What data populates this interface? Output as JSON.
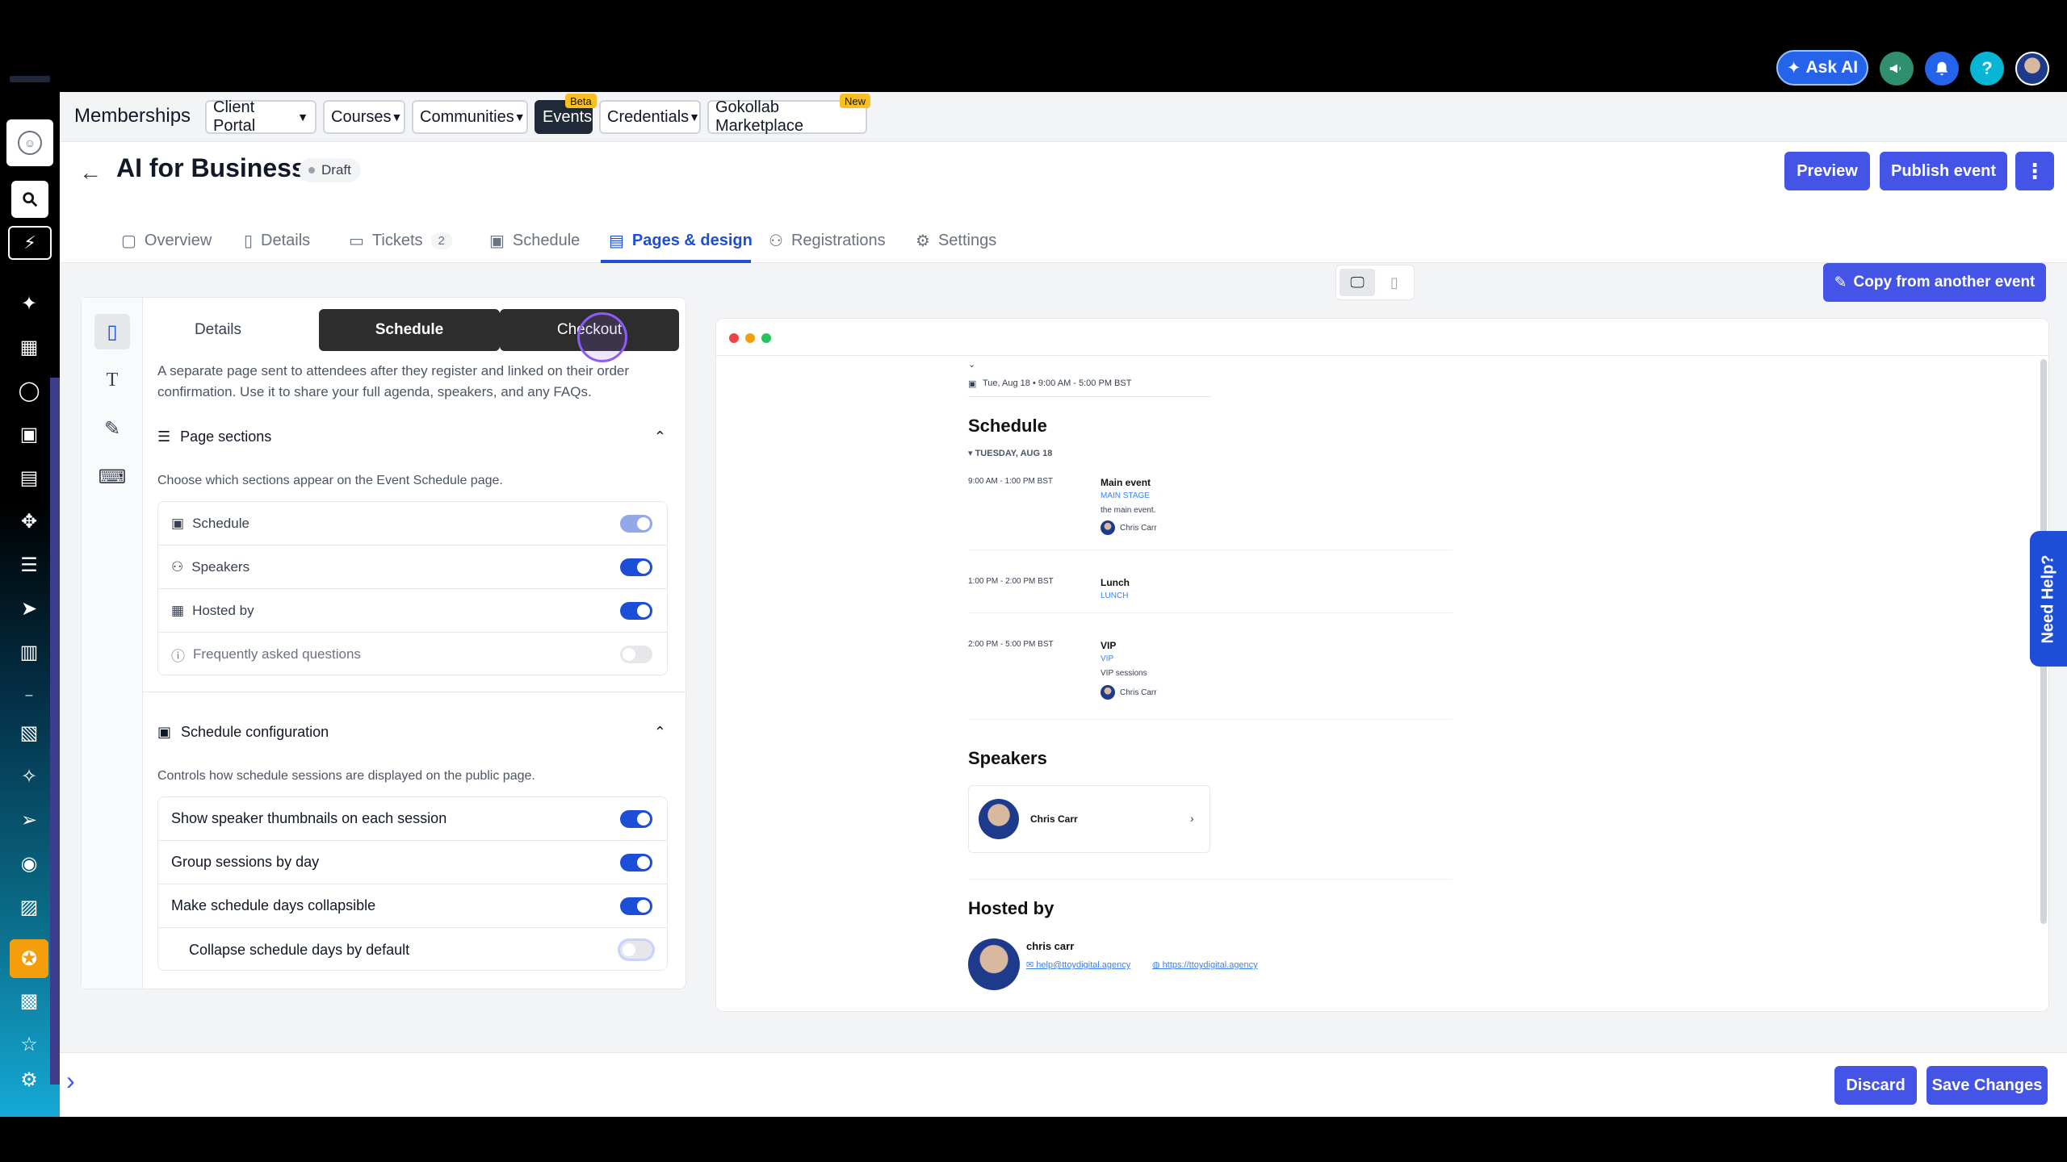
{
  "topbar": {
    "ask_ai": "Ask AI",
    "icons": [
      "phone-icon",
      "sparkle-icon",
      "megaphone-icon",
      "bell-icon",
      "help-icon",
      "user-avatar"
    ]
  },
  "nav": {
    "title": "Memberships",
    "items": [
      {
        "label": "Client Portal",
        "dropdown": true
      },
      {
        "label": "Courses",
        "dropdown": true
      },
      {
        "label": "Communities",
        "dropdown": true
      },
      {
        "label": "Events",
        "dropdown": false,
        "badge": "Beta",
        "active": true
      },
      {
        "label": "Credentials",
        "dropdown": true
      },
      {
        "label": "Gokollab Marketplace",
        "dropdown": false,
        "badge": "New"
      }
    ]
  },
  "header": {
    "title": "AI for Business",
    "status": "Draft",
    "preview_label": "Preview",
    "publish_label": "Publish event",
    "tabs": [
      {
        "label": "Overview"
      },
      {
        "label": "Details"
      },
      {
        "label": "Tickets",
        "count": "2"
      },
      {
        "label": "Schedule"
      },
      {
        "label": "Pages & design",
        "active": true
      },
      {
        "label": "Registrations"
      },
      {
        "label": "Settings"
      }
    ]
  },
  "editor": {
    "segments": [
      "Details",
      "Schedule",
      "Checkout"
    ],
    "intro": "A separate page sent to attendees after they register and linked on their order confirmation. Use it to share your full agenda, speakers, and any FAQs.",
    "page_sections": {
      "title": "Page sections",
      "desc": "Choose which sections appear on the Event Schedule page.",
      "rows": [
        {
          "label": "Schedule",
          "state": "locked"
        },
        {
          "label": "Speakers",
          "state": "on"
        },
        {
          "label": "Hosted by",
          "state": "on"
        },
        {
          "label": "Frequently asked questions",
          "state": "off"
        }
      ]
    },
    "schedule_config": {
      "title": "Schedule configuration",
      "desc": "Controls how schedule sessions are displayed on the public page.",
      "rows": [
        {
          "label": "Show speaker thumbnails on each session",
          "state": "on"
        },
        {
          "label": "Group sessions by day",
          "state": "on"
        },
        {
          "label": "Make schedule days collapsible",
          "state": "on"
        },
        {
          "label": "Collapse schedule days by default",
          "state": "off"
        }
      ]
    }
  },
  "preview": {
    "copy_label": "Copy from another event",
    "date_line": "Tue, Aug 18 • 9:00 AM - 5:00 PM BST",
    "schedule_heading": "Schedule",
    "day_label": "▾ TUESDAY, AUG 18",
    "sessions": [
      {
        "time": "9:00 AM - 1:00 PM BST",
        "title": "Main event",
        "tag": "MAIN STAGE",
        "desc": "the main event.",
        "speaker": "Chris Carr"
      },
      {
        "time": "1:00 PM - 2:00 PM BST",
        "title": "Lunch",
        "tag": "LUNCH",
        "desc": "",
        "speaker": ""
      },
      {
        "time": "2:00 PM - 5:00 PM BST",
        "title": "VIP",
        "tag": "VIP",
        "desc": "VIP sessions",
        "speaker": "Chris Carr"
      }
    ],
    "speakers_heading": "Speakers",
    "speaker_name": "Chris Carr",
    "hosted_heading": "Hosted by",
    "host_name": "chris carr",
    "host_email": "help@ttoydigital.agency",
    "host_url": "https://ttoydigital.agency"
  },
  "side_help": "Need Help?",
  "footer": {
    "discard": "Discard",
    "save": "Save Changes"
  },
  "colors": {
    "accent": "#4354e6",
    "active_tab": "#1d4ed8",
    "toggle_on": "#1d4ed8"
  }
}
